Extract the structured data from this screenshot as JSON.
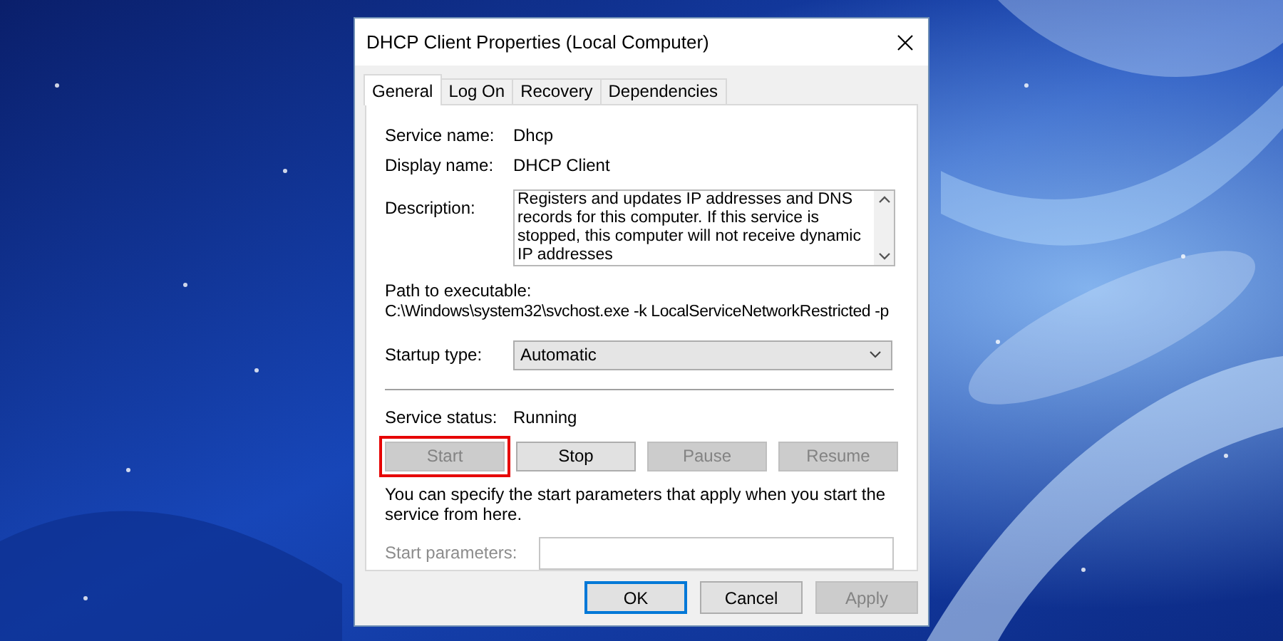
{
  "window": {
    "title": "DHCP Client Properties (Local Computer)"
  },
  "tabs": [
    {
      "label": "General",
      "selected": true
    },
    {
      "label": "Log On",
      "selected": false
    },
    {
      "label": "Recovery",
      "selected": false
    },
    {
      "label": "Dependencies",
      "selected": false
    }
  ],
  "service_name": {
    "label": "Service name:",
    "value": "Dhcp"
  },
  "display_name": {
    "label": "Display name:",
    "value": "DHCP Client"
  },
  "description": {
    "label": "Description:",
    "value": "Registers and updates IP addresses and DNS records for this computer. If this service is stopped, this computer will not receive dynamic IP addresses"
  },
  "path": {
    "label": "Path to executable:",
    "value": "C:\\Windows\\system32\\svchost.exe -k LocalServiceNetworkRestricted -p"
  },
  "startup_type": {
    "label": "Startup type:",
    "value": "Automatic"
  },
  "service_status": {
    "label": "Service status:",
    "value": "Running"
  },
  "control_buttons": [
    {
      "label": "Start",
      "disabled": true,
      "highlighted": true
    },
    {
      "label": "Stop",
      "disabled": false,
      "highlighted": false
    },
    {
      "label": "Pause",
      "disabled": true,
      "highlighted": false
    },
    {
      "label": "Resume",
      "disabled": true,
      "highlighted": false
    }
  ],
  "hint": "You can specify the start parameters that apply when you start the service from here.",
  "start_parameters": {
    "label": "Start parameters:",
    "disabled": true
  },
  "dialog_buttons": [
    {
      "label": "OK",
      "disabled": false,
      "default": true
    },
    {
      "label": "Cancel",
      "disabled": false,
      "default": false
    },
    {
      "label": "Apply",
      "disabled": true,
      "default": false
    }
  ]
}
